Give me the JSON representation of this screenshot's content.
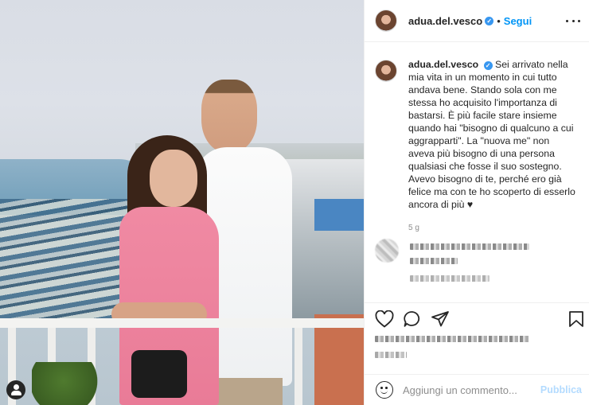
{
  "post": {
    "username": "adua.del.vesco",
    "verified_glyph": "✓",
    "separator": "•",
    "follow_label": "Segui",
    "caption": "Sei arrivato nella mia vita in un momento in cui tutto andava bene. Stando sola con me stessa ho acquisito l'importanza di bastarsi. È più facile stare insieme quando hai \"bisogno di qualcuno a cui aggrapparti\". La \"nuova me\" non aveva più bisogno di una persona qualsiasi che fosse il suo sostegno. Avevo bisogno di te, perché ero già felice ma con te ho scoperto di esserlo ancora di più ♥",
    "time_ago": "5 g"
  },
  "comment_box": {
    "placeholder": "Aggiungi un commento...",
    "publish_label": "Pubblica"
  },
  "icons": {
    "more": "more-options-icon",
    "like": "heart-icon",
    "comment": "comment-icon",
    "share": "paper-plane-icon",
    "save": "bookmark-icon",
    "emoji": "emoji-icon",
    "tag": "user-tag-icon"
  },
  "colors": {
    "accent": "#0095f6",
    "verified": "#3897f0",
    "publish_disabled": "#b3dbff",
    "dress": "#ef87a0"
  }
}
